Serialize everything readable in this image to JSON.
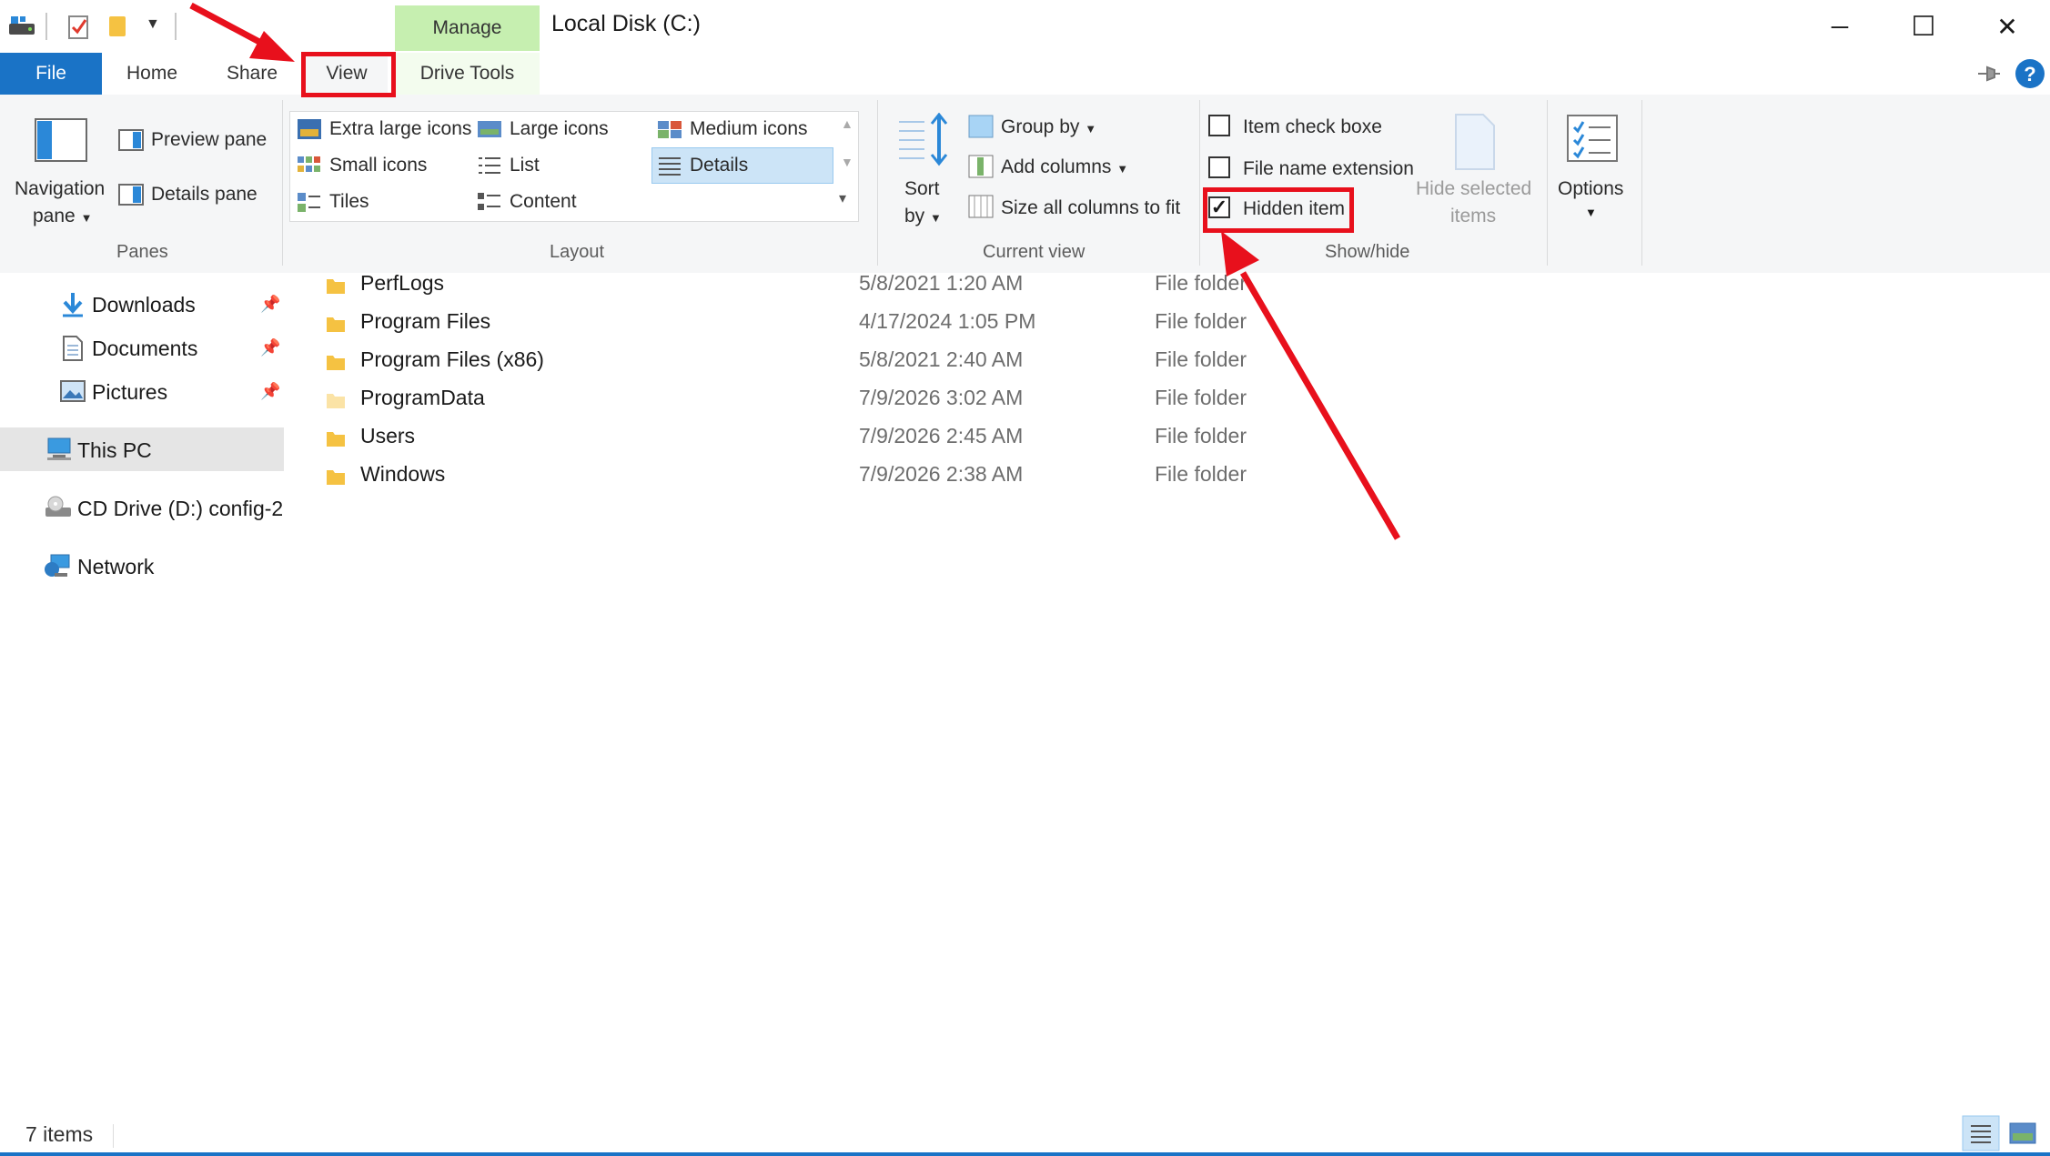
{
  "window": {
    "title": "Local Disk (C:)",
    "minimize_glyph": "─",
    "maximize_glyph": "☐",
    "close_glyph": "✕"
  },
  "tabs": {
    "file": "File",
    "home": "Home",
    "share": "Share",
    "view": "View",
    "manage": "Manage",
    "drive_tools": "Drive Tools"
  },
  "ribbon": {
    "panes": {
      "navigation_pane": "Navigation",
      "navigation_pane_line2": "pane",
      "preview_pane": "Preview pane",
      "details_pane": "Details pane",
      "group_label": "Panes"
    },
    "layout": {
      "items": [
        "Extra large icons",
        "Large icons",
        "Medium icons",
        "Small icons",
        "List",
        "Details",
        "Tiles",
        "Content"
      ],
      "selected": "Details",
      "group_label": "Layout"
    },
    "current_view": {
      "sort_by": "Sort",
      "sort_by_line2": "by",
      "group_by": "Group by",
      "add_columns": "Add columns",
      "size_all_columns": "Size all columns to fit",
      "group_label": "Current view"
    },
    "show_hide": {
      "item_check_boxes": "Item check boxe",
      "file_name_extensions": "File name extension",
      "hidden_items": "Hidden item",
      "hide_selected_items": "Hide selected",
      "hide_selected_items_line2": "items",
      "group_label": "Show/hide",
      "states": {
        "item_check_boxes": false,
        "file_name_extensions": false,
        "hidden_items": true
      }
    },
    "options": {
      "label": "Options"
    }
  },
  "nav": {
    "items": [
      {
        "label": "Downloads",
        "icon": "download-arrow-icon",
        "pinned": true
      },
      {
        "label": "Documents",
        "icon": "document-icon",
        "pinned": true
      },
      {
        "label": "Pictures",
        "icon": "picture-icon",
        "pinned": true
      },
      {
        "label": "This PC",
        "icon": "computer-icon",
        "selected": true
      },
      {
        "label": "CD Drive (D:) config-2",
        "icon": "cd-drive-icon"
      },
      {
        "label": "Network",
        "icon": "network-icon"
      }
    ]
  },
  "files": [
    {
      "name": "PerfLogs",
      "date": "5/8/2021 1:20 AM",
      "type": "File folder"
    },
    {
      "name": "Program Files",
      "date": "4/17/2024 1:05 PM",
      "type": "File folder"
    },
    {
      "name": "Program Files (x86)",
      "date": "5/8/2021 2:40 AM",
      "type": "File folder"
    },
    {
      "name": "ProgramData",
      "date": "7/9/2026 3:02 AM",
      "type": "File folder",
      "hidden": true
    },
    {
      "name": "Users",
      "date": "7/9/2026 2:45 AM",
      "type": "File folder"
    },
    {
      "name": "Windows",
      "date": "7/9/2026 2:38 AM",
      "type": "File folder"
    }
  ],
  "status": {
    "item_count": "7 items"
  },
  "colors": {
    "accent": "#1a73c6",
    "manage_tab": "#c6efb0",
    "annotation_red": "#e8101c",
    "folder_yellow": "#f5c242"
  }
}
